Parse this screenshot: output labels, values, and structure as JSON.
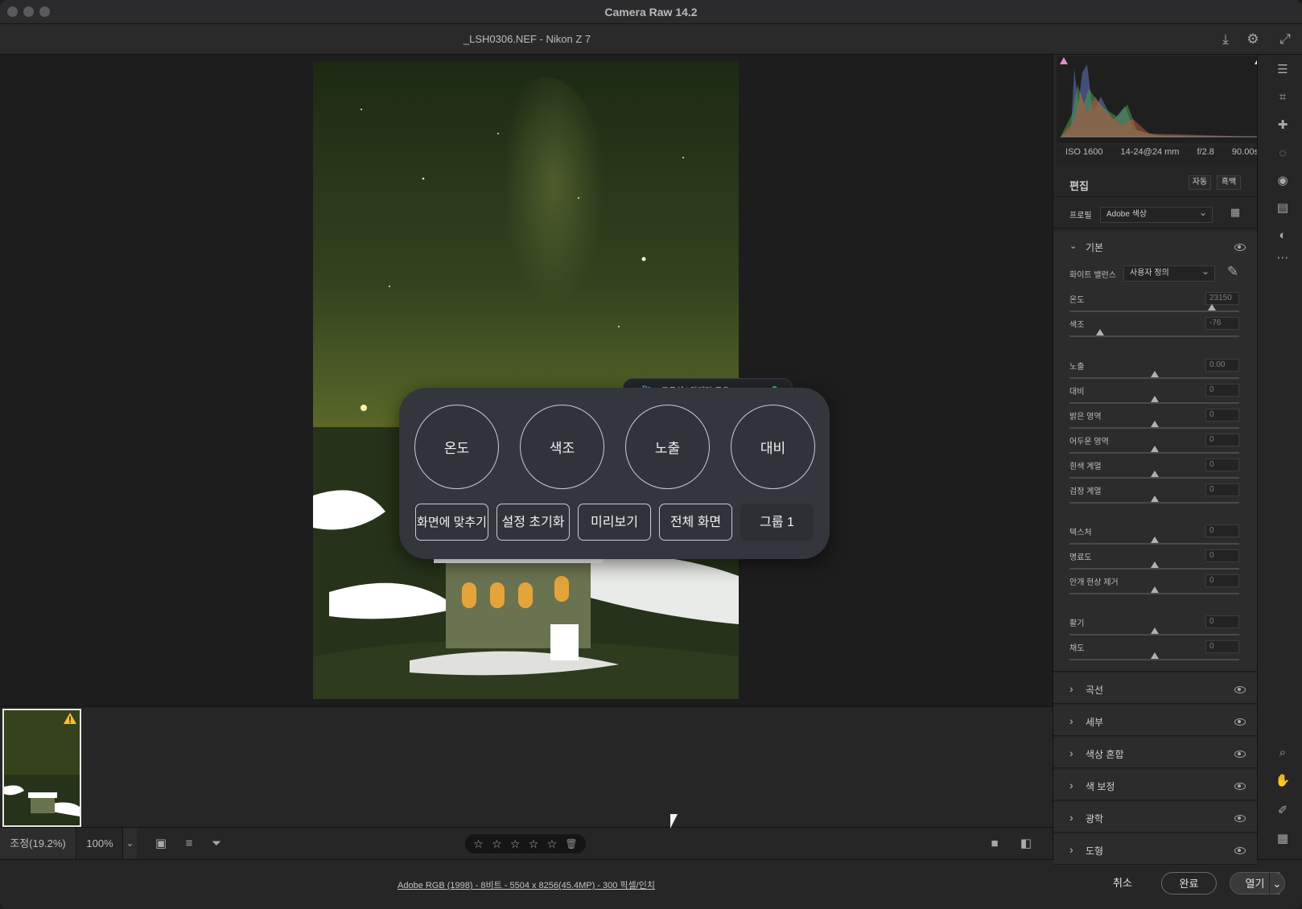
{
  "window": {
    "title": "Camera Raw 14.2"
  },
  "header": {
    "filename": "_LSH0306.NEF  -  Nikon Z 7"
  },
  "ps_overlay": {
    "badge": {
      "app": "Ps",
      "label": "포토샵 | 카메라 로우"
    },
    "dials": [
      "온도",
      "색조",
      "노출",
      "대비"
    ],
    "buttons": [
      "화면에 맞추기",
      "설정 초기화",
      "미리보기",
      "전체 화면",
      "그룹 1"
    ]
  },
  "bottombar": {
    "zoom_label": "조정(19.2%)",
    "zoom_value": "100%",
    "stars": [
      "☆",
      "☆",
      "☆",
      "☆",
      "☆"
    ]
  },
  "footer": {
    "info": "Adobe RGB (1998) - 8비트 - 5504 x 8256(45.4MP) - 300 픽셀/인치",
    "cancel": "취소",
    "done": "완료",
    "open": "열기"
  },
  "exif": {
    "iso": "ISO 1600",
    "lens": "14-24@24 mm",
    "aperture": "f/2.8",
    "shutter": "90.00s"
  },
  "edit": {
    "title": "편집",
    "auto": "자동",
    "bw": "흑백",
    "profile_label": "프로필",
    "profile_value": "Adobe 색상",
    "basic": "기본",
    "wb_label": "화이트 밸런스",
    "wb_value": "사용자 정의",
    "sliders": [
      {
        "label": "온도",
        "value": "23150",
        "pos": 0.84
      },
      {
        "label": "색조",
        "value": "-76",
        "pos": 0.18
      },
      {
        "label": "노출",
        "value": "0.00",
        "pos": 0.5
      },
      {
        "label": "대비",
        "value": "0",
        "pos": 0.5
      },
      {
        "label": "밝은 영역",
        "value": "0",
        "pos": 0.5
      },
      {
        "label": "어두운 영역",
        "value": "0",
        "pos": 0.5
      },
      {
        "label": "흰색 계열",
        "value": "0",
        "pos": 0.5
      },
      {
        "label": "검정 계열",
        "value": "0",
        "pos": 0.5
      },
      {
        "label": "텍스처",
        "value": "0",
        "pos": 0.5
      },
      {
        "label": "명료도",
        "value": "0",
        "pos": 0.5
      },
      {
        "label": "안개 현상 제거",
        "value": "0",
        "pos": 0.5
      },
      {
        "label": "활기",
        "value": "0",
        "pos": 0.5
      },
      {
        "label": "채도",
        "value": "0",
        "pos": 0.5
      }
    ],
    "sections": [
      "곡선",
      "세부",
      "색상 혼합",
      "색 보정",
      "광학",
      "도형"
    ]
  },
  "colors": {
    "accent_green": "#3ed159",
    "panel_bg": "#33373d",
    "warning": "#f5c12e"
  }
}
